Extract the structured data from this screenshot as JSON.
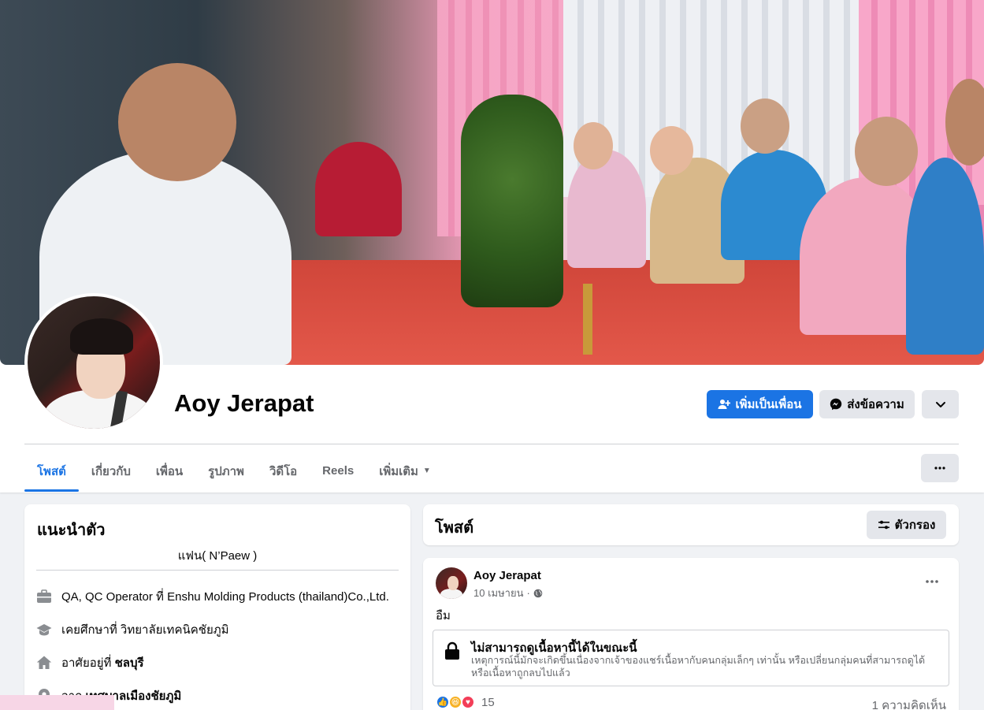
{
  "profile": {
    "name": "Aoy Jerapat",
    "cover_alt": "cover-photo",
    "avatar_alt": "profile-picture"
  },
  "actions": {
    "add_friend": "เพิ่มเป็นเพื่อน",
    "message": "ส่งข้อความ"
  },
  "tabs": [
    {
      "label": "โพสต์",
      "active": true
    },
    {
      "label": "เกี่ยวกับ",
      "active": false
    },
    {
      "label": "เพื่อน",
      "active": false
    },
    {
      "label": "รูปภาพ",
      "active": false
    },
    {
      "label": "วิดีโอ",
      "active": false
    },
    {
      "label": "Reels",
      "active": false
    },
    {
      "label": "เพิ่มเติม",
      "active": false
    }
  ],
  "intro": {
    "title": "แนะนำตัว",
    "bio": "แฟน( N’Paew )",
    "work": "QA, QC Operator ที่ Enshu Molding Products (thailand)Co.,Ltd.",
    "education": "เคยศึกษาที่ วิทยาลัยเทคนิคชัยภูมิ",
    "lives_prefix": "อาศัยอยู่ที่ ",
    "lives_place": "ชลบุรี",
    "from_prefix": "จาก ",
    "from_place": "เทศบาลเมืองชัยภูมิ"
  },
  "posts": {
    "title": "โพสต์",
    "filter_label": "ตัวกรอง",
    "items": [
      {
        "author": "Aoy Jerapat",
        "date": "10 เมษายน",
        "text": "อืม",
        "unavailable_title": "ไม่สามารถดูเนื้อหานี้ได้ในขณะนี้",
        "unavailable_desc": "เหตุการณ์นี้มักจะเกิดขึ้นเนื่องจากเจ้าของแชร์เนื้อหากับคนกลุ่มเล็กๆ เท่านั้น หรือเปลี่ยนกลุ่มคนที่สามารถดูได้ หรือเนื้อหาถูกลบไปแล้ว",
        "reaction_count": "15",
        "comment_count": "1 ความคิดเห็น"
      }
    ]
  },
  "colors": {
    "accent": "#1b74e4",
    "secondary_button": "#e4e6eb",
    "page_bg": "#f0f2f5",
    "muted_text": "#65676b"
  },
  "icons": {
    "add_friend": "add-person-icon",
    "message": "messenger-icon",
    "more": "chevron-down-icon",
    "tabs_more": "ellipsis-icon",
    "filter": "sliders-icon",
    "work": "briefcase-icon",
    "education": "graduation-cap-icon",
    "lives": "home-icon",
    "from": "location-pin-icon",
    "audience": "globe-icon",
    "lock": "lock-icon"
  }
}
